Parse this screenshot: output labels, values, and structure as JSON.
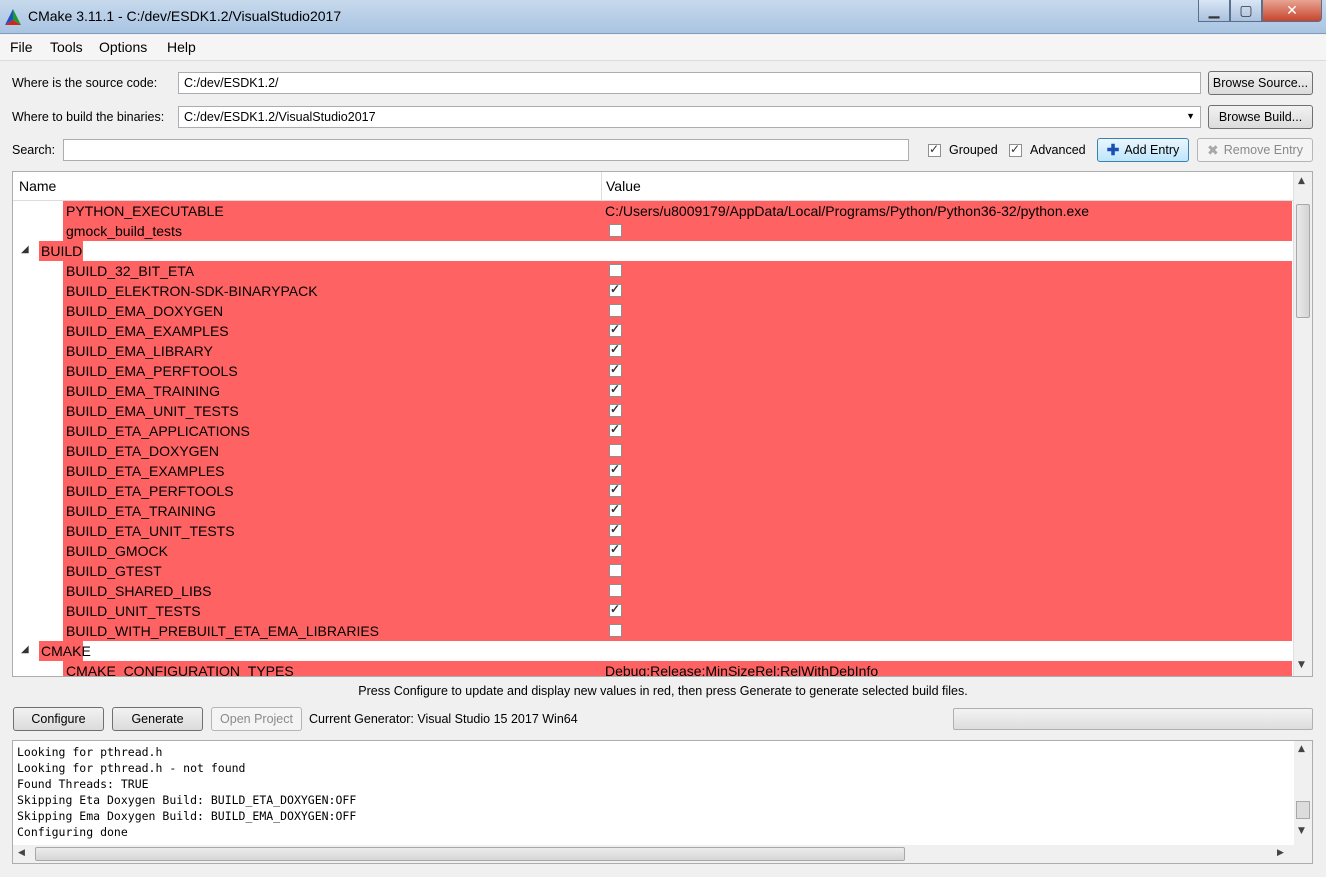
{
  "window": {
    "title": "CMake 3.11.1 - C:/dev/ESDK1.2/VisualStudio2017",
    "controls": {
      "minimize": "▁",
      "maximize": "▢",
      "close": "✕"
    }
  },
  "menu": [
    "File",
    "Tools",
    "Options",
    "Help"
  ],
  "source": {
    "label": "Where is the source code:",
    "value": "C:/dev/ESDK1.2/",
    "button": "Browse Source..."
  },
  "build": {
    "label": "Where to build the binaries:",
    "value": "C:/dev/ESDK1.2/VisualStudio2017",
    "button": "Browse Build..."
  },
  "search": {
    "label": "Search:",
    "value": ""
  },
  "toggles": {
    "grouped": "Grouped",
    "advanced": "Advanced"
  },
  "entries": {
    "add": "Add Entry",
    "remove": "Remove Entry"
  },
  "table": {
    "headers": {
      "name": "Name",
      "value": "Value"
    },
    "rows": [
      {
        "kind": "entry",
        "name": "PYTHON_EXECUTABLE",
        "value": "C:/Users/u8009179/AppData/Local/Programs/Python/Python36-32/python.exe"
      },
      {
        "kind": "bool",
        "name": "gmock_build_tests",
        "checked": false
      },
      {
        "kind": "group",
        "name": "BUILD"
      },
      {
        "kind": "bool",
        "name": "BUILD_32_BIT_ETA",
        "checked": false
      },
      {
        "kind": "bool",
        "name": "BUILD_ELEKTRON-SDK-BINARYPACK",
        "checked": true
      },
      {
        "kind": "bool",
        "name": "BUILD_EMA_DOXYGEN",
        "checked": false
      },
      {
        "kind": "bool",
        "name": "BUILD_EMA_EXAMPLES",
        "checked": true
      },
      {
        "kind": "bool",
        "name": "BUILD_EMA_LIBRARY",
        "checked": true
      },
      {
        "kind": "bool",
        "name": "BUILD_EMA_PERFTOOLS",
        "checked": true
      },
      {
        "kind": "bool",
        "name": "BUILD_EMA_TRAINING",
        "checked": true
      },
      {
        "kind": "bool",
        "name": "BUILD_EMA_UNIT_TESTS",
        "checked": true
      },
      {
        "kind": "bool",
        "name": "BUILD_ETA_APPLICATIONS",
        "checked": true
      },
      {
        "kind": "bool",
        "name": "BUILD_ETA_DOXYGEN",
        "checked": false
      },
      {
        "kind": "bool",
        "name": "BUILD_ETA_EXAMPLES",
        "checked": true
      },
      {
        "kind": "bool",
        "name": "BUILD_ETA_PERFTOOLS",
        "checked": true
      },
      {
        "kind": "bool",
        "name": "BUILD_ETA_TRAINING",
        "checked": true
      },
      {
        "kind": "bool",
        "name": "BUILD_ETA_UNIT_TESTS",
        "checked": true
      },
      {
        "kind": "bool",
        "name": "BUILD_GMOCK",
        "checked": true
      },
      {
        "kind": "bool",
        "name": "BUILD_GTEST",
        "checked": false
      },
      {
        "kind": "bool",
        "name": "BUILD_SHARED_LIBS",
        "checked": false
      },
      {
        "kind": "bool",
        "name": "BUILD_UNIT_TESTS",
        "checked": true
      },
      {
        "kind": "bool",
        "name": "BUILD_WITH_PREBUILT_ETA_EMA_LIBRARIES",
        "checked": false
      },
      {
        "kind": "group",
        "name": "CMAKE"
      },
      {
        "kind": "entry",
        "name": "CMAKE_CONFIGURATION_TYPES",
        "value": "Debug;Release;MinSizeRel;RelWithDebInfo"
      }
    ]
  },
  "hint": "Press Configure to update and display new values in red, then press Generate to generate selected build files.",
  "actions": {
    "configure": "Configure",
    "generate": "Generate",
    "open_project": "Open Project",
    "generator": "Current Generator: Visual Studio 15 2017 Win64"
  },
  "log": [
    "Looking for pthread.h",
    "Looking for pthread.h - not found",
    "Found Threads: TRUE",
    "Skipping Eta Doxygen Build: BUILD_ETA_DOXYGEN:OFF",
    "Skipping Ema Doxygen Build: BUILD_EMA_DOXYGEN:OFF",
    "Configuring done"
  ],
  "colors": {
    "changed_row": "#ff6262",
    "titlebar": "#b5cde8"
  }
}
